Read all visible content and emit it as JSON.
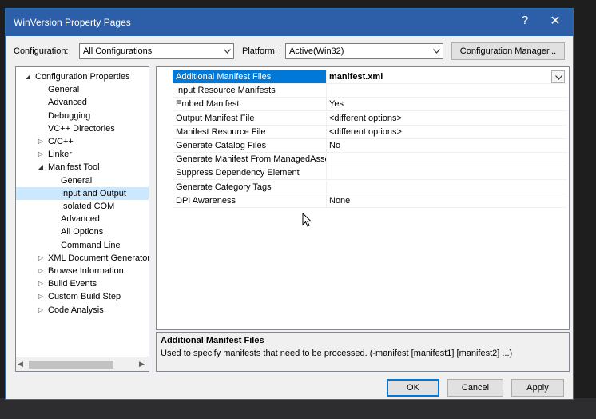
{
  "dialog": {
    "title": "WinVersion Property Pages",
    "help_glyph": "?",
    "close_glyph": "✕"
  },
  "toolbar": {
    "configuration_label": "Configuration:",
    "configuration_value": "All Configurations",
    "platform_label": "Platform:",
    "platform_value": "Active(Win32)",
    "config_manager_label": "Configuration Manager..."
  },
  "tree": {
    "items": [
      {
        "label": "Configuration Properties",
        "expander": "◢"
      },
      {
        "label": "General",
        "expander": ""
      },
      {
        "label": "Advanced",
        "expander": ""
      },
      {
        "label": "Debugging",
        "expander": ""
      },
      {
        "label": "VC++ Directories",
        "expander": ""
      },
      {
        "label": "C/C++",
        "expander": "▷"
      },
      {
        "label": "Linker",
        "expander": "▷"
      },
      {
        "label": "Manifest Tool",
        "expander": "◢"
      },
      {
        "label": "General",
        "expander": ""
      },
      {
        "label": "Input and Output",
        "expander": ""
      },
      {
        "label": "Isolated COM",
        "expander": ""
      },
      {
        "label": "Advanced",
        "expander": ""
      },
      {
        "label": "All Options",
        "expander": ""
      },
      {
        "label": "Command Line",
        "expander": ""
      },
      {
        "label": "XML Document Generator",
        "expander": "▷"
      },
      {
        "label": "Browse Information",
        "expander": "▷"
      },
      {
        "label": "Build Events",
        "expander": "▷"
      },
      {
        "label": "Custom Build Step",
        "expander": "▷"
      },
      {
        "label": "Code Analysis",
        "expander": "▷"
      }
    ],
    "selected": "Input and Output"
  },
  "grid": {
    "rows": [
      {
        "name": "Additional Manifest Files",
        "value": "manifest.xml"
      },
      {
        "name": "Input Resource Manifests",
        "value": ""
      },
      {
        "name": "Embed Manifest",
        "value": "Yes"
      },
      {
        "name": "Output Manifest File",
        "value": "<different options>"
      },
      {
        "name": "Manifest Resource File",
        "value": "<different options>"
      },
      {
        "name": "Generate Catalog Files",
        "value": "No"
      },
      {
        "name": "Generate Manifest From ManagedAssembly",
        "value": ""
      },
      {
        "name": "Suppress Dependency Element",
        "value": ""
      },
      {
        "name": "Generate Category Tags",
        "value": ""
      },
      {
        "name": "DPI Awareness",
        "value": "None"
      }
    ]
  },
  "description": {
    "title": "Additional Manifest Files",
    "text": "Used to specify manifests that need to be processed. (-manifest [manifest1] [manifest2] ...)"
  },
  "buttons": {
    "ok": "OK",
    "cancel": "Cancel",
    "apply": "Apply"
  },
  "colors": {
    "titlebar": "#2d5ea8",
    "selection": "#0078d7",
    "tree_selection": "#cce8ff"
  }
}
